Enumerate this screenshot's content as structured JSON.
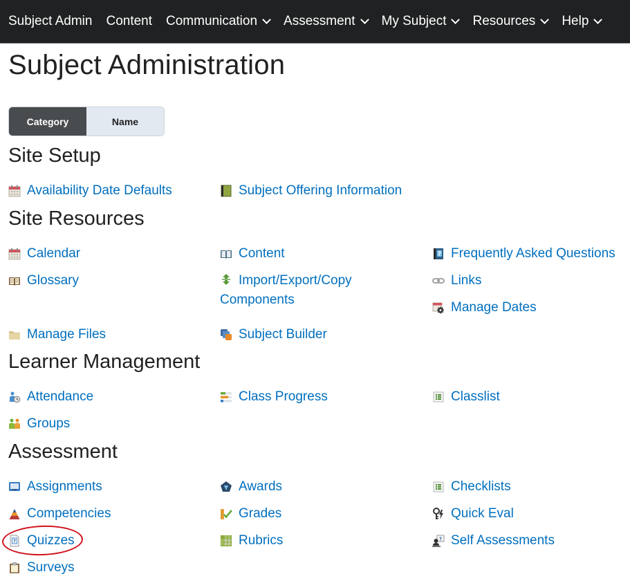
{
  "navbar": {
    "items": [
      {
        "label": "Subject Admin",
        "has_dropdown": false
      },
      {
        "label": "Content",
        "has_dropdown": false
      },
      {
        "label": "Communication",
        "has_dropdown": true
      },
      {
        "label": "Assessment",
        "has_dropdown": true
      },
      {
        "label": "My Subject",
        "has_dropdown": true
      },
      {
        "label": "Resources",
        "has_dropdown": true
      },
      {
        "label": "Help",
        "has_dropdown": true
      }
    ]
  },
  "page_title": "Subject Administration",
  "view_toggle": {
    "options": [
      {
        "label": "Category",
        "selected": true
      },
      {
        "label": "Name",
        "selected": false
      }
    ]
  },
  "sections": [
    {
      "title": "Site Setup",
      "links": [
        {
          "label": "Availability Date Defaults",
          "icon": "calendar-icon"
        },
        {
          "label": "Subject Offering Information",
          "icon": "book-icon"
        }
      ]
    },
    {
      "title": "Site Resources",
      "links": [
        {
          "label": "Calendar",
          "icon": "calendar-icon"
        },
        {
          "label": "Content",
          "icon": "open-book-icon"
        },
        {
          "label": "Frequently Asked Questions",
          "icon": "faq-book-icon"
        },
        {
          "label": "Glossary",
          "icon": "glossary-book-icon"
        },
        {
          "label": "Import/Export/Copy Components",
          "icon": "import-export-arrows-icon"
        },
        {
          "label": "Links",
          "icon": "chain-link-icon"
        },
        {
          "label": "Manage Dates",
          "icon": "calendar-gear-icon"
        },
        {
          "label": "Manage Files",
          "icon": "folder-icon"
        },
        {
          "label": "Subject Builder",
          "icon": "layered-squares-icon"
        }
      ]
    },
    {
      "title": "Learner Management",
      "links": [
        {
          "label": "Attendance",
          "icon": "person-clock-icon"
        },
        {
          "label": "Class Progress",
          "icon": "progress-bars-icon"
        },
        {
          "label": "Classlist",
          "icon": "list-icon"
        },
        {
          "label": "Groups",
          "icon": "people-group-icon"
        }
      ]
    },
    {
      "title": "Assessment",
      "links": [
        {
          "label": "Assignments",
          "icon": "monitor-icon"
        },
        {
          "label": "Awards",
          "icon": "award-badge-icon"
        },
        {
          "label": "Checklists",
          "icon": "checklist-icon"
        },
        {
          "label": "Competencies",
          "icon": "pyramid-icon"
        },
        {
          "label": "Grades",
          "icon": "ruler-check-icon"
        },
        {
          "label": "Quick Eval",
          "icon": "quick-eval-icon"
        },
        {
          "label": "Quizzes",
          "icon": "quiz-document-icon",
          "highlighted": true
        },
        {
          "label": "Rubrics",
          "icon": "rubric-grid-icon"
        },
        {
          "label": "Self Assessments",
          "icon": "self-assessment-icon"
        },
        {
          "label": "Surveys",
          "icon": "clipboard-icon"
        }
      ]
    }
  ],
  "colors": {
    "navbar_bg": "#202122",
    "link": "#006fbf",
    "heading": "#202122",
    "toggle_active": "#494c4e",
    "toggle_inactive": "#e3e9f1",
    "annotation_circle": "#d0101a"
  }
}
